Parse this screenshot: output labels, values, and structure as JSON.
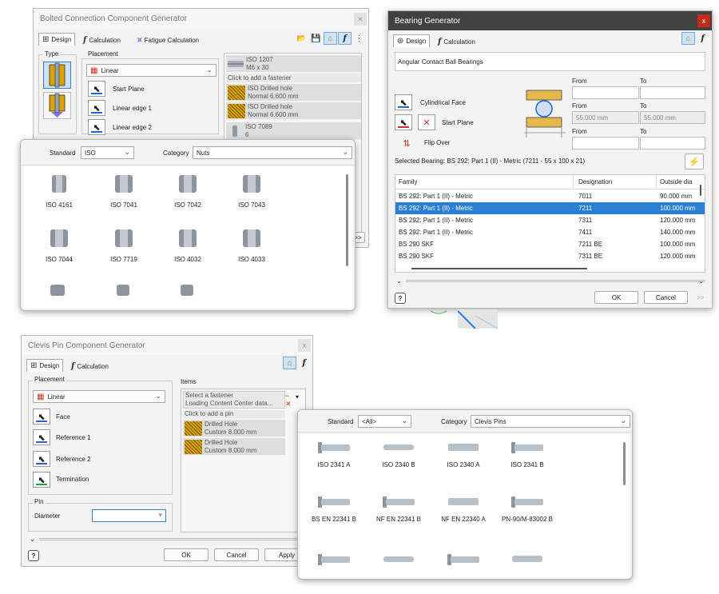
{
  "bolted": {
    "title": "Bolted Connection Component Generator",
    "tabs": [
      "Design",
      "Calculation",
      "Fatigue Calculation"
    ],
    "type_label": "Type",
    "placement_label": "Placement",
    "placement_value": "Linear",
    "picks": [
      "Start Plane",
      "Linear edge 1",
      "Linear edge 2"
    ],
    "items": [
      {
        "line1": "ISO 1207",
        "line2": "M6 x 30"
      },
      {
        "line1": "Click to add a fastener",
        "line2": ""
      },
      {
        "line1": "ISO Drilled hole",
        "line2": "Normal 6.600 mm"
      },
      {
        "line1": "ISO Drilled hole",
        "line2": "Normal 6.600 mm"
      },
      {
        "line1": "ISO 7089",
        "line2": "6"
      }
    ],
    "more_btn": ">>"
  },
  "nuts_picker": {
    "standard_label": "Standard",
    "standard_value": "ISO",
    "category_label": "Category",
    "category_value": "Nuts",
    "items": [
      "ISO 4161",
      "ISO 7041",
      "ISO 7042",
      "ISO 7043",
      "ISO 7044",
      "ISO 7719",
      "ISO 4032",
      "ISO 4033"
    ]
  },
  "bearing": {
    "title": "Bearing Generator",
    "close": "x",
    "tabs": [
      "Design",
      "Calculation"
    ],
    "type_text": "Angular Contact Ball Bearings",
    "picks": [
      "Cylindrical Face",
      "Start Plane",
      "Flip Over"
    ],
    "from_label": "From",
    "to_label": "To",
    "from_value": "55.000 mm",
    "to_value": "55.000 mm",
    "selected": "Selected Bearing: BS 292: Part 1 (II) - Metric (7211 - 55 x 100 x 21)",
    "columns": [
      "Family",
      "Designation",
      "Outside dia"
    ],
    "rows": [
      [
        "BS 292: Part 1 (II) - Metric",
        "7011",
        "90.000 mm"
      ],
      [
        "BS 292: Part 1 (II) - Metric",
        "7211",
        "100.000 mm"
      ],
      [
        "BS 292: Part 1 (II) - Metric",
        "7311",
        "120.000 mm"
      ],
      [
        "BS 292: Part 1 (II) - Metric",
        "7411",
        "140.000 mm"
      ],
      [
        "BS 290 SKF",
        "7211 BE",
        "100.000 mm"
      ],
      [
        "BS 290 SKF",
        "7311 BE",
        "120.000 mm"
      ]
    ],
    "ok": "OK",
    "cancel": "Cancel",
    "more": ">>"
  },
  "clevis": {
    "title": "Clevis Pin Component Generator",
    "close": "x",
    "tabs": [
      "Design",
      "Calculation"
    ],
    "placement_label": "Placement",
    "placement_value": "Linear",
    "picks": [
      "Face",
      "Reference 1",
      "Reference 2",
      "Termination"
    ],
    "pin_label": "Pin",
    "diameter_label": "Diameter",
    "items_label": "Items",
    "items": [
      {
        "line1": "Select a fastener",
        "line2": "Loading Content Center data..."
      },
      {
        "line1": "Click to add a pin",
        "line2": ""
      },
      {
        "line1": "Drilled Hole",
        "line2": "Custom 8.000 mm"
      },
      {
        "line1": "Drilled Hole",
        "line2": "Custom 8.000 mm"
      }
    ],
    "ok": "OK",
    "cancel": "Cancel",
    "apply": "Apply"
  },
  "pins_picker": {
    "standard_label": "Standard",
    "standard_value": "<All>",
    "category_label": "Category",
    "category_value": "Clevis Pins",
    "items": [
      "ISO 2341 A",
      "ISO 2340 B",
      "ISO 2340 A",
      "ISO 2341 B",
      "BS EN 22341 B",
      "NF EN 22341 B",
      "NF EN 22340 A",
      "PN-90/M-83002 B"
    ]
  }
}
